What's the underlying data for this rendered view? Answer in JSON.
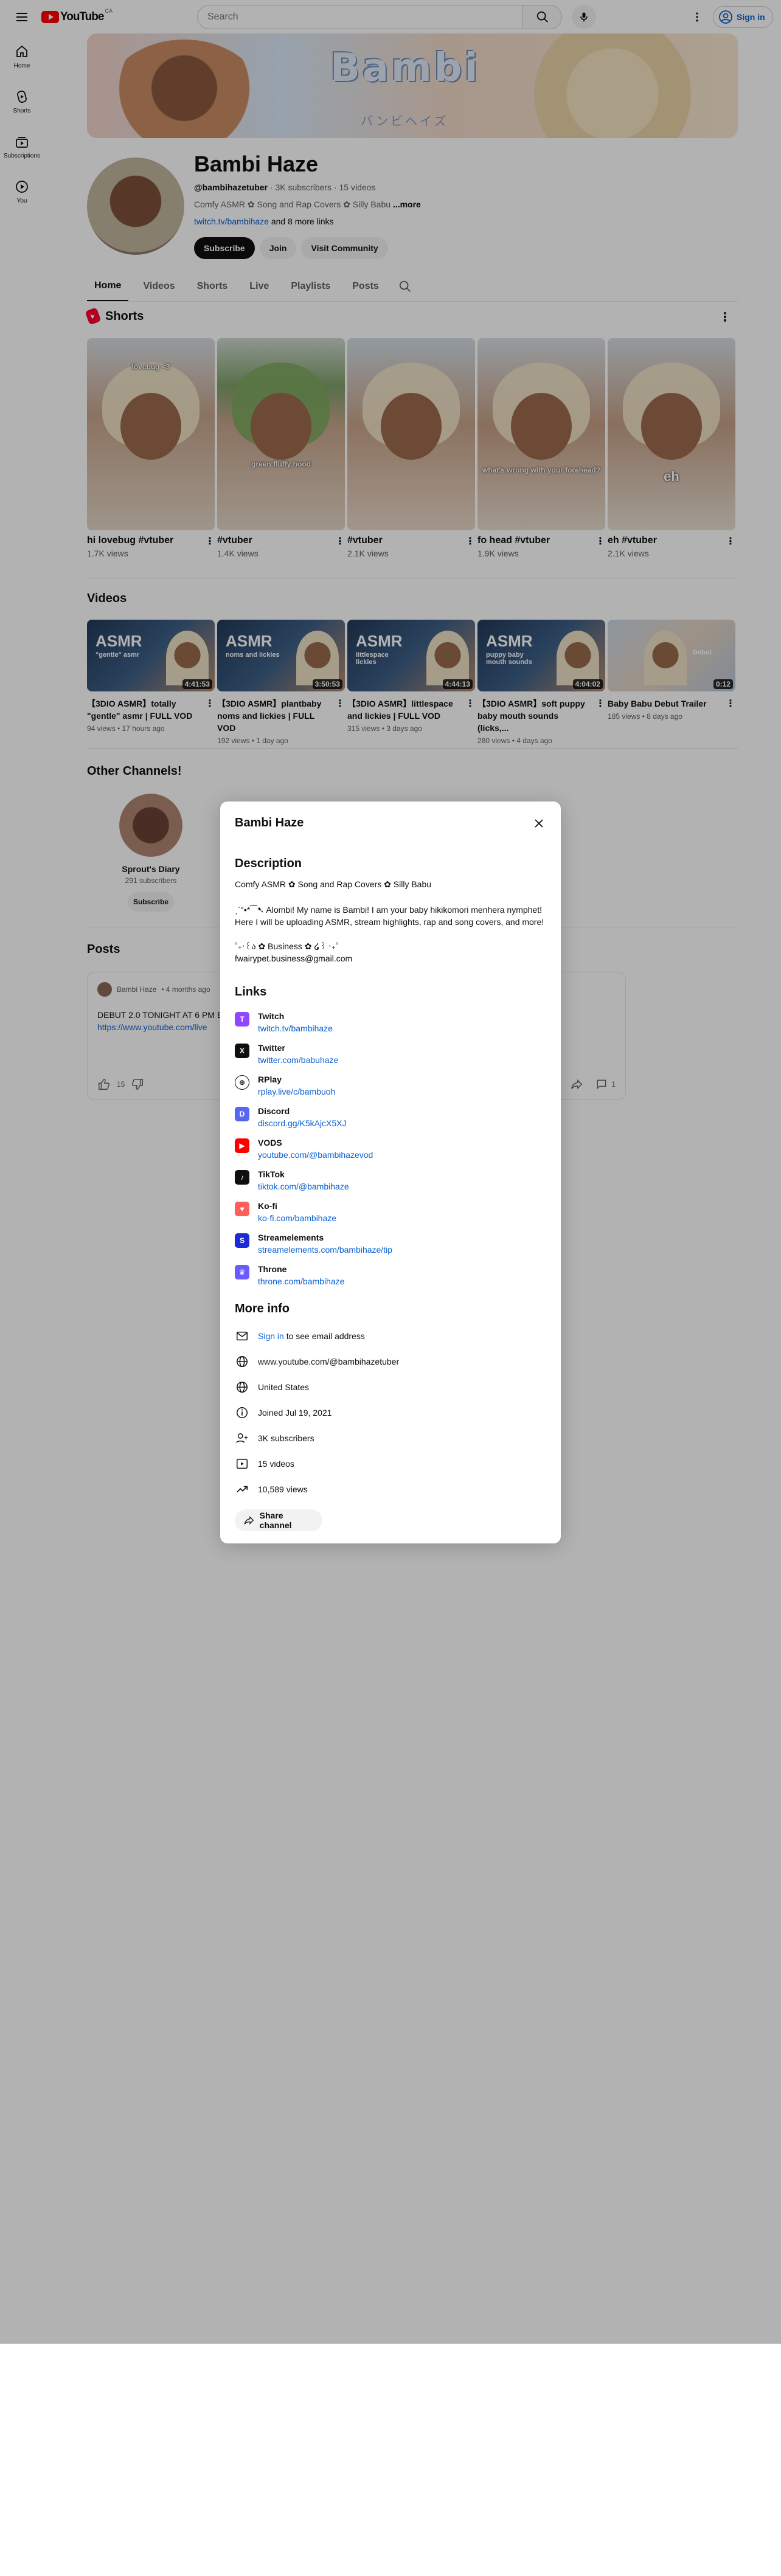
{
  "topbar": {
    "logo_text": "YouTube",
    "logo_cc": "CA",
    "search_placeholder": "Search",
    "signin_label": "Sign in"
  },
  "rail": [
    {
      "label": "Home",
      "icon": "home-icon"
    },
    {
      "label": "Shorts",
      "icon": "shorts-icon"
    },
    {
      "label": "Subscriptions",
      "icon": "subscriptions-icon"
    },
    {
      "label": "You",
      "icon": "you-icon"
    }
  ],
  "banner": {
    "title": "Bambi",
    "subtitle": "バンビヘイズ"
  },
  "channel": {
    "name": "Bambi Haze",
    "handle": "@bambihazetuber",
    "stats": " · 3K subscribers · 15 videos",
    "desc": "Comfy ASMR ✿ Song and Rap Covers ✿ Silly Babu ",
    "more": "...more",
    "link": "twitch.tv/bambihaze",
    "more_links": " and 8 more links",
    "subscribe": "Subscribe",
    "join": "Join",
    "visit": "Visit Community"
  },
  "tabs": [
    "Home",
    "Videos",
    "Shorts",
    "Live",
    "Playlists",
    "Posts"
  ],
  "shorts": {
    "title": "Shorts",
    "items": [
      {
        "title": "hi lovebug #vtuber",
        "views": "1.7K views",
        "cap": "lovebug <3"
      },
      {
        "title": "#vtuber",
        "views": "1.4K views",
        "cap": "green fluffy hood"
      },
      {
        "title": "#vtuber",
        "views": "2.1K views",
        "cap": ""
      },
      {
        "title": "fo head #vtuber",
        "views": "1.9K views",
        "cap": "what's wrong with your forehead?"
      },
      {
        "title": "eh #vtuber",
        "views": "2.1K views",
        "cap": "eh"
      }
    ]
  },
  "videos": {
    "title": "Videos",
    "items": [
      {
        "title": "【3DIO ASMR】totally \"gentle\" asmr | FULL VOD",
        "meta": "94 views • 17 hours ago",
        "duration": "4:41:53",
        "asmr": "ASMR",
        "sub": "\"gentle\" asmr"
      },
      {
        "title": "【3DIO ASMR】plantbaby noms and lickies | FULL VOD",
        "meta": "192 views • 1 day ago",
        "duration": "3:50:53",
        "asmr": "ASMR",
        "sub": "noms and lickies"
      },
      {
        "title": "【3DIO ASMR】littlespace and lickies | FULL VOD",
        "meta": "315 views • 3 days ago",
        "duration": "4:44:13",
        "asmr": "ASMR",
        "sub": "littlespace lickies"
      },
      {
        "title": "【3DIO ASMR】soft puppy baby mouth sounds (licks,...",
        "meta": "280 views • 4 days ago",
        "duration": "4:04:02",
        "asmr": "ASMR",
        "sub": "puppy baby mouth sounds"
      },
      {
        "title": "Baby Babu Debut Trailer",
        "meta": "185 views • 8 days ago",
        "duration": "0:12",
        "asmr": "",
        "sub": "Debut"
      }
    ]
  },
  "other": {
    "title": "Other Channels!",
    "name": "Sprout's Diary",
    "subs": "291 subscribers",
    "subscribe": "Subscribe"
  },
  "posts": {
    "title": "Posts",
    "author": "Bambi Haze",
    "time": "• 4 months ago",
    "text": "DEBUT 2.0 TONIGHT AT 6 PM E",
    "link": "https://www.youtube.com/live",
    "likes": "15",
    "comments": "1"
  },
  "dialog": {
    "title": "Bambi Haze",
    "description_h": "Description",
    "desc1": "Comfy ASMR ✿ Song and Rap Covers ✿ Silly Babu",
    "desc2": "ˏˋ°•*⁀➷ Alombi! My name is Bambi! I am your baby hikikomori menhera nymphet!",
    "desc3": "Here I will be uploading ASMR, stream highlights, rap and song covers, and more!",
    "desc4": "˚₊‧꒰ა ✿ Business ✿ ໒꒱ ‧₊˚",
    "desc5": "fwairypet.business@gmail.com",
    "links_h": "Links",
    "links": [
      {
        "name": "Twitch",
        "url": "twitch.tv/bambihaze",
        "icon": "twitch-icon",
        "color": "#9146ff",
        "glyph": "T"
      },
      {
        "name": "Twitter",
        "url": "twitter.com/babuhaze",
        "icon": "x-icon",
        "color": "#0f0f0f",
        "glyph": "X"
      },
      {
        "name": "RPlay",
        "url": "rplay.live/c/bambuoh",
        "icon": "globe-icon",
        "color": "#ffffff",
        "glyph": "⊕"
      },
      {
        "name": "Discord",
        "url": "discord.gg/K5kAjcX5XJ",
        "icon": "discord-icon",
        "color": "#5865f2",
        "glyph": "D"
      },
      {
        "name": "VODS",
        "url": "youtube.com/@bambihazevod",
        "icon": "youtube-icon",
        "color": "#ff0000",
        "glyph": "▶"
      },
      {
        "name": "TikTok",
        "url": "tiktok.com/@bambihaze",
        "icon": "tiktok-icon",
        "color": "#0f0f0f",
        "glyph": "♪"
      },
      {
        "name": "Ko-fi",
        "url": "ko-fi.com/bambihaze",
        "icon": "kofi-icon",
        "color": "#ff5e5b",
        "glyph": "♥"
      },
      {
        "name": "Streamelements",
        "url": "streamelements.com/bambihaze/tip",
        "icon": "streamelements-icon",
        "color": "#1b2bd8",
        "glyph": "S"
      },
      {
        "name": "Throne",
        "url": "throne.com/bambihaze",
        "icon": "throne-icon",
        "color": "#6b5bff",
        "glyph": "♛"
      }
    ],
    "more_h": "More info",
    "signin_link": "Sign in",
    "signin_rest": " to see email address",
    "url": "www.youtube.com/@bambihazetuber",
    "country": "United States",
    "joined": "Joined Jul 19, 2021",
    "subs": "3K subscribers",
    "videos": "15 videos",
    "views": "10,589 views",
    "share": "Share channel"
  }
}
